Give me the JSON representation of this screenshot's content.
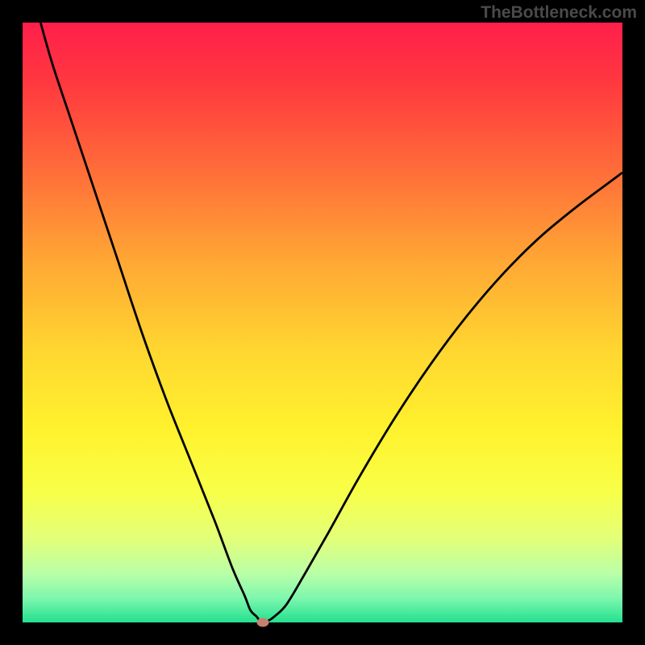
{
  "watermark": "TheBottleneck.com",
  "chart_data": {
    "type": "line",
    "title": "",
    "xlabel": "",
    "ylabel": "",
    "xlim": [
      0,
      100
    ],
    "ylim": [
      0,
      100
    ],
    "gradient_stops": [
      {
        "offset": 0.0,
        "color": "#ff1f4b"
      },
      {
        "offset": 0.1,
        "color": "#ff383f"
      },
      {
        "offset": 0.25,
        "color": "#ff6e39"
      },
      {
        "offset": 0.4,
        "color": "#ffa834"
      },
      {
        "offset": 0.55,
        "color": "#ffd730"
      },
      {
        "offset": 0.68,
        "color": "#fff22e"
      },
      {
        "offset": 0.78,
        "color": "#f8ff47"
      },
      {
        "offset": 0.86,
        "color": "#e3ff78"
      },
      {
        "offset": 0.92,
        "color": "#b8ffa8"
      },
      {
        "offset": 0.96,
        "color": "#7cf7ae"
      },
      {
        "offset": 1.0,
        "color": "#24e08e"
      }
    ],
    "series": [
      {
        "name": "bottleneck-curve",
        "x": [
          3,
          5,
          8,
          12,
          16,
          20,
          24,
          28,
          32,
          35,
          37,
          38,
          39,
          39.5,
          40,
          41,
          42,
          44,
          47,
          51,
          56,
          62,
          68,
          74,
          80,
          86,
          92,
          98,
          100
        ],
        "y": [
          100,
          93,
          84,
          72,
          60,
          48,
          37,
          27,
          17,
          9,
          4.5,
          2,
          1,
          0.3,
          0,
          0.3,
          1,
          3,
          8,
          15,
          24,
          34,
          43,
          51,
          58,
          64,
          69,
          73.5,
          75
        ]
      }
    ],
    "marker": {
      "x": 40,
      "y": 0,
      "color": "#c77f72"
    }
  }
}
